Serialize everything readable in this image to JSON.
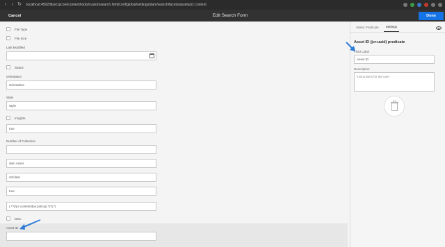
{
  "browser": {
    "url": "localhost:4502/libs/cq/core/content/tools/customsearch.html/conf/global/settings/dam/search/facets/assets/jcr:content"
  },
  "header": {
    "cancel_label": "Cancel",
    "title": "Edit Search Form",
    "done_label": "Done"
  },
  "form": {
    "fields": [
      {
        "kind": "checkbox",
        "label": "File Type"
      },
      {
        "kind": "checkbox",
        "label": "File Size"
      },
      {
        "kind": "label",
        "label": "Last Modified"
      },
      {
        "kind": "checkbox",
        "label": "Status"
      },
      {
        "kind": "label",
        "label": "Orientation"
      },
      {
        "kind": "input",
        "value": "Orientation"
      },
      {
        "kind": "label",
        "label": "Style"
      },
      {
        "kind": "input",
        "value": "Style"
      },
      {
        "kind": "checkbox",
        "label": "Insights"
      },
      {
        "kind": "input",
        "value": "true"
      },
      {
        "kind": "label",
        "label": "Number of Collection"
      },
      {
        "kind": "input",
        "value": "dam Asset"
      },
      {
        "kind": "input",
        "value": "nt:folder"
      },
      {
        "kind": "input",
        "value": "true"
      },
      {
        "kind": "input",
        "value": "(.*?)/jcr:content/dps:policy(/.*)?(.*)"
      },
      {
        "kind": "checkbox",
        "label": "DSC"
      },
      {
        "kind": "label",
        "label": "Asset ID"
      }
    ]
  },
  "panel": {
    "tabs": [
      "Select Predicate",
      "Settings"
    ],
    "active_tab": "Settings",
    "predicate_title": "Asset ID (jcr:uuid) predicate",
    "field_label_caption": "Field Label",
    "field_label_value": "Asset ID",
    "description_caption": "Description",
    "description_placeholder": "Instructions for the user"
  },
  "colors": {
    "accent": "#1473e6",
    "header": "#323232",
    "arrow": "#2d7bd8"
  }
}
